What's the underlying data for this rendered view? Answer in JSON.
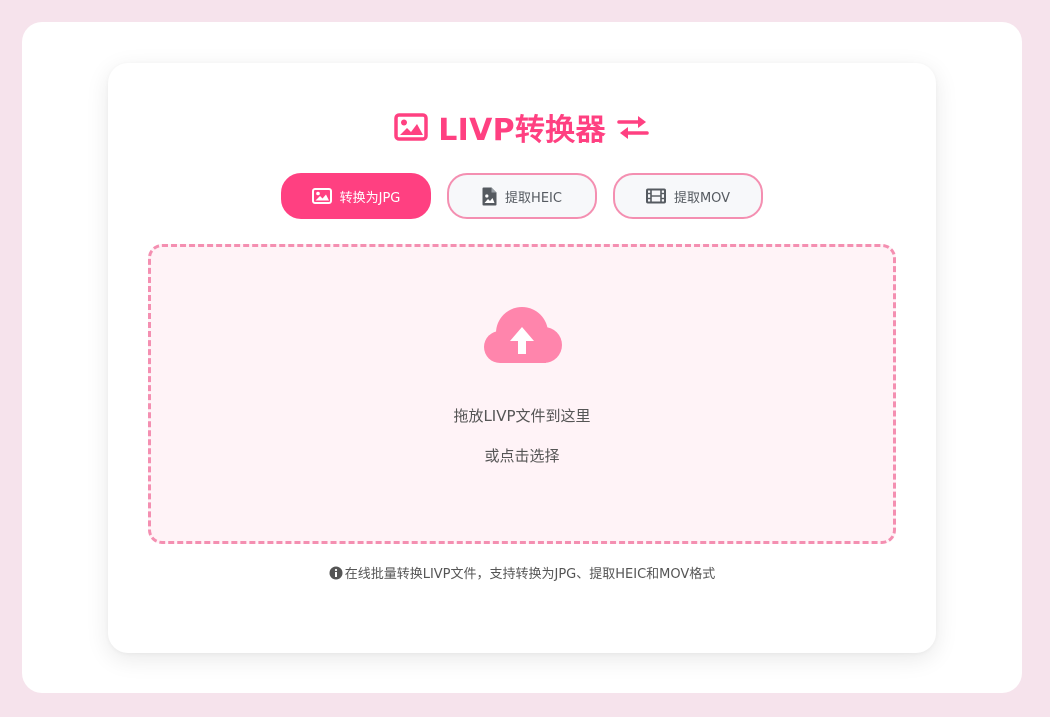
{
  "colors": {
    "accent": "#ff4081",
    "accent_light": "#f48fb1",
    "dropzone_bg": "#fff3f7",
    "page_bg": "#f6e3ec",
    "text": "#555555"
  },
  "header": {
    "title": "LIVP转换器",
    "left_icon": "image-icon",
    "right_icon": "exchange-arrows-icon"
  },
  "tabs": [
    {
      "label": "转换为JPG",
      "icon": "image-icon",
      "active": true
    },
    {
      "label": "提取HEIC",
      "icon": "file-image-icon",
      "active": false
    },
    {
      "label": "提取MOV",
      "icon": "film-icon",
      "active": false
    }
  ],
  "dropzone": {
    "icon": "cloud-upload-icon",
    "main_text": "拖放LIVP文件到这里",
    "sub_text": "或点击选择"
  },
  "footer": {
    "icon": "info-circle-icon",
    "text": "在线批量转换LIVP文件，支持转换为JPG、提取HEIC和MOV格式"
  }
}
